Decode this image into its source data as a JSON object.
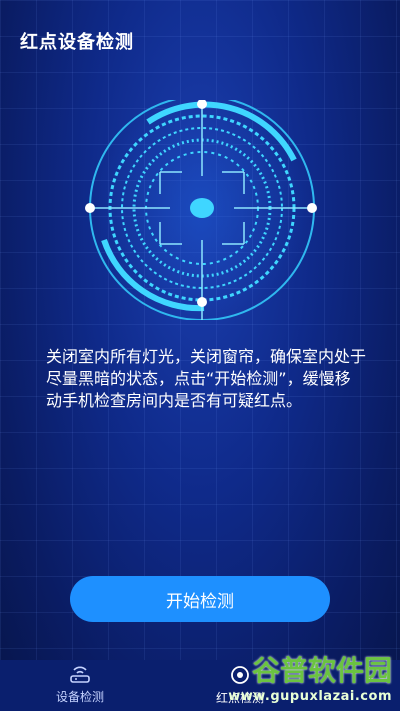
{
  "header": {
    "title": "红点设备检测"
  },
  "instructions": {
    "text": "关闭室内所有灯光，关闭窗帘，确保室内处于尽量黑暗的状态，点击“开始检测”，缓慢移动手机检查房间内是否有可疑红点。"
  },
  "action": {
    "start_label": "开始检测"
  },
  "tabbar": {
    "tabs": [
      {
        "label": "设备检测",
        "icon": "router-icon",
        "active": false
      },
      {
        "label": "红点检测",
        "icon": "target-icon",
        "active": true
      }
    ]
  },
  "watermark": {
    "brand": "谷普软件园",
    "url": "www.gupuxlazai.com"
  },
  "colors": {
    "accent": "#1e90ff",
    "radar": "#3fd6ff",
    "brand_green": "#6bc341"
  }
}
